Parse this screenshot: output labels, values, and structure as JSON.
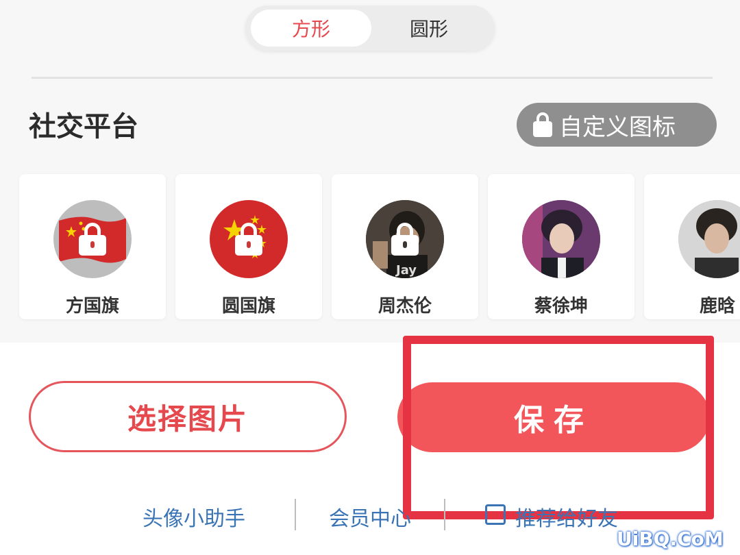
{
  "shape_toggle": {
    "options": [
      "方形",
      "圆形"
    ],
    "selected": "方形"
  },
  "section": {
    "title": "社交平台",
    "custom_icon_label": "自定义图标"
  },
  "avatars": [
    {
      "label": "方国旗",
      "locked": true
    },
    {
      "label": "圆国旗",
      "locked": true
    },
    {
      "label": "周杰伦",
      "locked": true,
      "photo_caption": "Jay"
    },
    {
      "label": "蔡徐坤",
      "locked": false
    },
    {
      "label": "鹿晗",
      "locked": false
    }
  ],
  "actions": {
    "select_image": "选择图片",
    "save": "保存"
  },
  "bottom_links": [
    "头像小助手",
    "会员中心",
    "推荐给好友"
  ],
  "watermark": "UiBQ.CoM",
  "colors": {
    "accent": "#e5484d",
    "save_bg": "#f2555a",
    "highlight": "#e53344",
    "link": "#3a74b5",
    "flag_red": "#d22a2a",
    "flag_star": "#f5d200"
  }
}
